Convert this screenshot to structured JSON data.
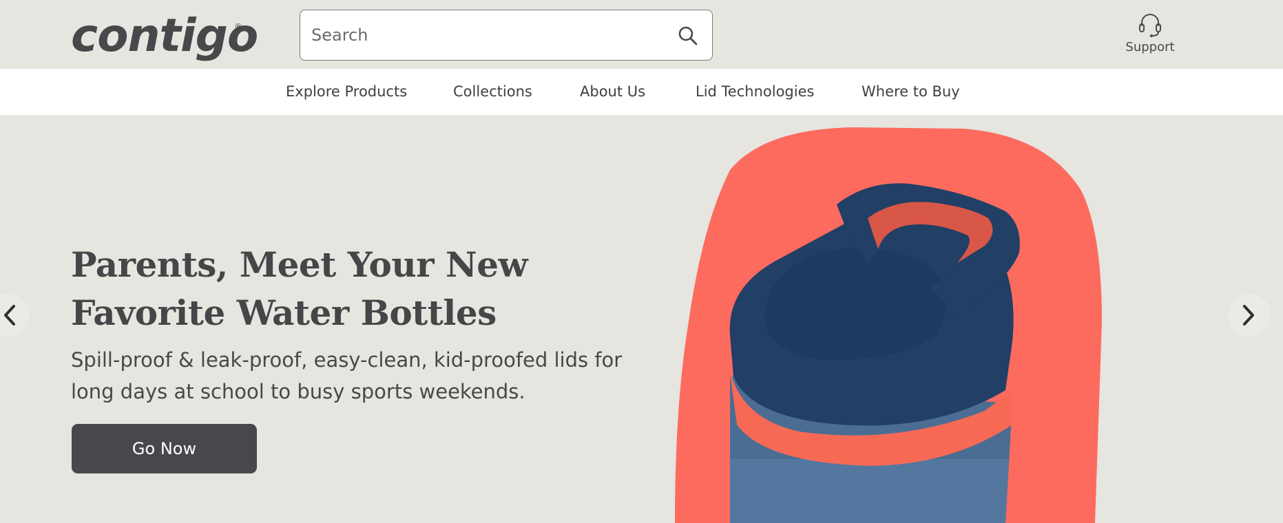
{
  "header": {
    "logo_text": "contigo",
    "logo_mark": "®",
    "search": {
      "placeholder": "Search",
      "icon": "search-icon"
    },
    "support": {
      "label": "Support",
      "icon": "headset-icon"
    }
  },
  "nav": {
    "items": [
      {
        "label": "Explore Products"
      },
      {
        "label": "Collections"
      },
      {
        "label": "About Us"
      },
      {
        "label": "Lid Technologies"
      },
      {
        "label": "Where to Buy"
      }
    ]
  },
  "hero": {
    "title_lines": [
      "Parents, Meet Your New",
      "Favorite Water Bottles"
    ],
    "subtitle_lines": [
      "Spill-proof & leak-proof, easy-clean, kid-proofed lids for",
      "long days at school to busy sports weekends."
    ],
    "cta_label": "Go Now",
    "image": {
      "description_icon": "water-bottle-image",
      "blob_color": "#fd6b5f",
      "lid_color": "#213f67",
      "band_color": "#f66a55",
      "body_color": "#4b6d93"
    },
    "prev_icon": "chevron-left-icon",
    "next_icon": "chevron-right-icon"
  },
  "colors": {
    "background": "#e6e5df",
    "text": "#464548",
    "button": "#48474b"
  }
}
